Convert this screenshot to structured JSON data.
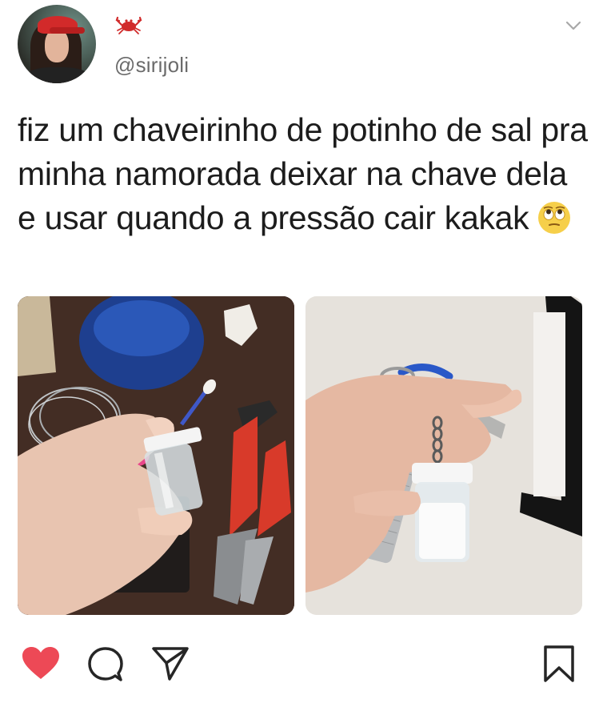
{
  "post": {
    "author": {
      "emoji_name": "crab",
      "handle": "@sirijoli"
    },
    "text": "fiz um chaveirinho de potinho de sal pra minha namorada deixar na chave dela e usar quando a pressão cair kakak",
    "text_emoji": "face-with-rolling-eyes",
    "images": [
      {
        "description_key": "left-photo",
        "content": "hand-holding-salt-vial-with-pliers-and-wire"
      },
      {
        "description_key": "right-photo",
        "content": "keychain-with-salt-vial"
      }
    ]
  },
  "actions": {
    "like_color": "#ed4956",
    "icons": [
      "heart-icon",
      "comment-icon",
      "share-icon",
      "bookmark-icon"
    ]
  },
  "colors": {
    "text": "#1c1c1c",
    "handle": "#6b6b6b",
    "background": "#ffffff"
  }
}
